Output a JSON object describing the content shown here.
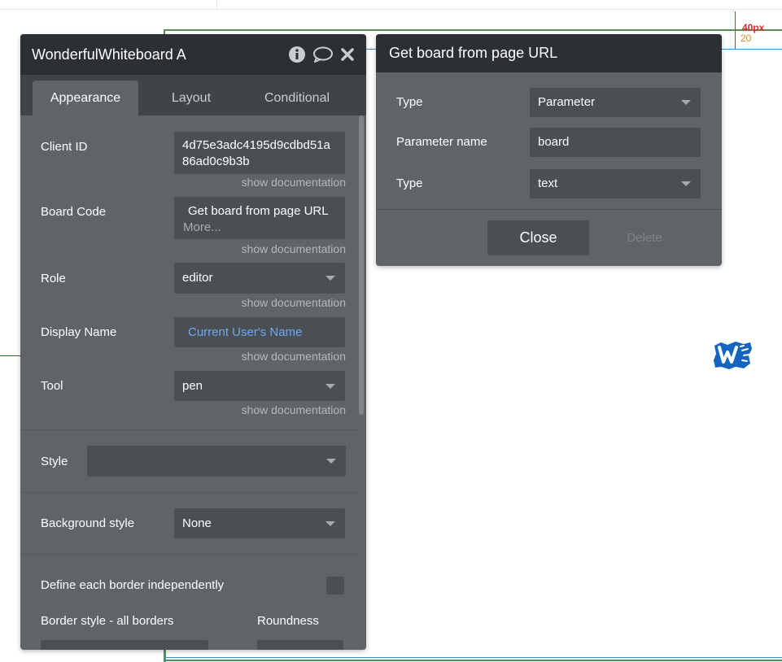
{
  "ruler": {
    "label_a": "40px",
    "label_b": "20"
  },
  "panel": {
    "title": "WonderfulWhiteboard A",
    "icons": [
      "info-icon",
      "comment-icon",
      "close-icon"
    ],
    "tabs": [
      {
        "label": "Appearance",
        "active": true
      },
      {
        "label": "Layout",
        "active": false
      },
      {
        "label": "Conditional",
        "active": false
      }
    ],
    "doc_label": "show documentation",
    "client_id": {
      "label": "Client ID",
      "value_line1": "4d75e3adc4195d9cdbd51a",
      "value_line2": "86ad0c9b3b"
    },
    "board_code": {
      "label": "Board Code",
      "value": "Get board from page URL",
      "more": "More..."
    },
    "role": {
      "label": "Role",
      "value": "editor"
    },
    "display_name": {
      "label": "Display Name",
      "value": "Current User's Name"
    },
    "tool": {
      "label": "Tool",
      "value": "pen"
    },
    "style": {
      "label": "Style",
      "value": ""
    },
    "background_style": {
      "label": "Background style",
      "value": "None"
    },
    "define_border": {
      "label": "Define each border independently"
    },
    "border_style": {
      "label": "Border style - all borders"
    },
    "roundness": {
      "label": "Roundness"
    }
  },
  "dialog": {
    "title": "Get board from page URL",
    "type1": {
      "label": "Type",
      "value": "Parameter"
    },
    "param_name": {
      "label": "Parameter name",
      "value": "board"
    },
    "type2": {
      "label": "Type",
      "value": "text"
    },
    "close_label": "Close",
    "delete_label": "Delete"
  },
  "colors": {
    "link_blue": "#6fa8f0",
    "header_dark": "#2c3034",
    "panel_grey": "#5f6468",
    "logo_blue": "#1565c0"
  }
}
